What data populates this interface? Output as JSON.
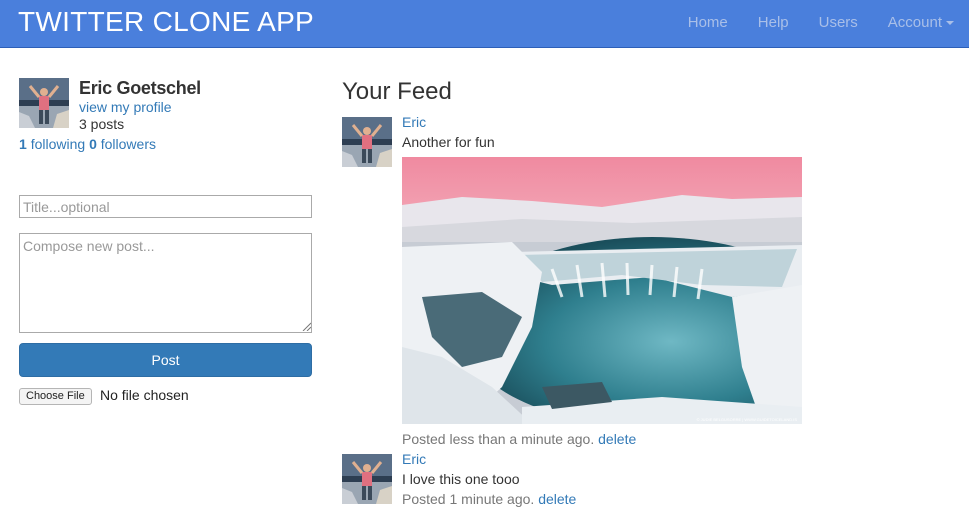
{
  "navbar": {
    "brand": "TWITTER CLONE APP",
    "items": [
      {
        "label": "Home"
      },
      {
        "label": "Help"
      },
      {
        "label": "Users"
      },
      {
        "label": "Account"
      }
    ]
  },
  "profile": {
    "name": "Eric Goetschel",
    "view_profile_link": "view my profile",
    "posts_count": "3 posts",
    "following_count": "1",
    "following_label": "following",
    "followers_count": "0",
    "followers_label": "followers"
  },
  "composer": {
    "title_placeholder": "Title...optional",
    "body_placeholder": "Compose new post...",
    "post_button": "Post",
    "file_button": "Choose File",
    "file_status": "No file chosen"
  },
  "feed": {
    "title": "Your Feed",
    "posts": [
      {
        "author": "Eric",
        "content": "Another for fun",
        "posted": "Posted less than a minute ago.",
        "delete_label": "delete",
        "image": "frozen-waterfall-photo",
        "image_credit": "© JUDIE BELGUSORRE | WWW.GUIDETOICELAND.IS"
      },
      {
        "author": "Eric",
        "content": "I love this one tooo",
        "posted": "Posted 1 minute ago.",
        "delete_label": "delete"
      }
    ]
  },
  "colors": {
    "navbar": "#4a7fdc",
    "link": "#337ab7",
    "button": "#337ab7",
    "meta_text": "#777777"
  }
}
